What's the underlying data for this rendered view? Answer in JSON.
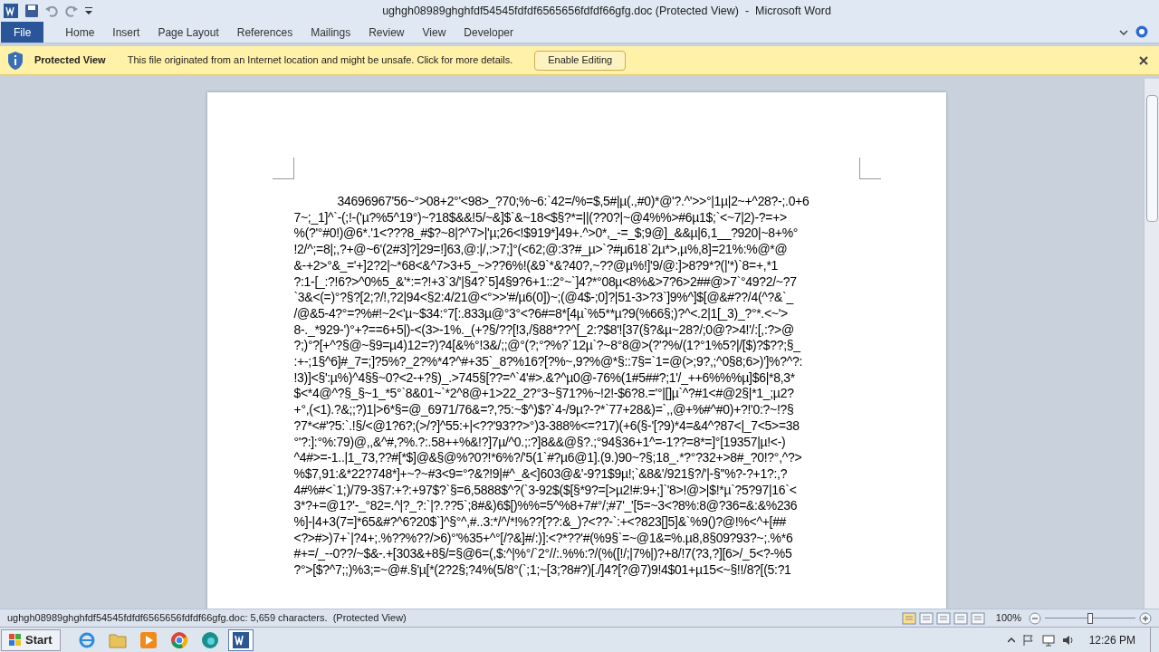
{
  "window": {
    "title": "ughgh08989ghghfdf54545fdfdf6565656fdfdf66gfg.doc (Protected View)  -  Microsoft Word"
  },
  "tabs": [
    {
      "label": "File",
      "selected": true
    },
    {
      "label": "Home",
      "selected": false
    },
    {
      "label": "Insert",
      "selected": false
    },
    {
      "label": "Page Layout",
      "selected": false
    },
    {
      "label": "References",
      "selected": false
    },
    {
      "label": "Mailings",
      "selected": false
    },
    {
      "label": "Review",
      "selected": false
    },
    {
      "label": "View",
      "selected": false
    },
    {
      "label": "Developer",
      "selected": false
    }
  ],
  "message_bar": {
    "title": "Protected View",
    "text": "This file originated from an Internet location and might be unsafe. Click for more details.",
    "button": "Enable Editing"
  },
  "document": {
    "lines": [
      "34696967'56~°>08+2°'<98>_?70;%~6:`42=/%=$,5#|µ(.,#0)*@'?.^'>>°|1µ|2~+^28?-;.0+6",
      "7~;_1]^`-(;!-('µ?%5^19°)~?18$&&!5/~&]$`&~18<$§?*=||(??0?|~@4%%>#6µ1$;`<~7|2)-?=+>",
      "%(?'°#0!)@6*.'1<???8_#$?~8|?^7>|'µ;26<!$919*]49+.^>0*,_-=_$;9@]_&&µ|6,1__?920|~8+%°",
      "!2/^;=8|;,?+@~6'(2#3]?]29=!]63,@:|/,:>7;]°(<62;@:3?#_µ>`?#µ618`2µ*>,µ%,8]=21%:%@*@",
      "&-+2>°&_='+]2?2|~*68<&^7>3+5_~>??6%!(&9`*&?40?,~??@µ%!]'9/@:]>8?9*?(|'*)`8=+,*1",
      "?:1-[_:?!6?>^0%5_&'*:=?!+3`3/'|§4?`5]4§9?6+1::2°~`]4?*°08µ<8%&>7?6>2##@>7`°49?2/~?7",
      "`3&<(=)°?§?[2;?/!,?2|94<§2:4/21@<°>>'#/µ6(0])~;(@4$-;0]?|51-3>?3`]9%^]$[@&#??/4(^?&`_",
      "/@&5-4?°=?%#!~2<'µ~$34:°7[:.833µ@°3°<?6#=8*[4µ`%5**µ?9(%66§;)?^<.2|1[_3)_?°*.<~'>",
      "8-._*929-')°+?==6+5|)-<(3>-1%._(+?§/??[!3,/§88*??^[_2:?$8'![37(§?&µ~28?/;0@?>4!'/:[,:?>@",
      "?;)°?[+^?§@~§9=µ4)12=?)?4[&%°!3&/;;@°(?;°?%?`12µ`?~8°8@>(?'?%/(1?°1%5?|/[$)?$??;§_",
      ":+-;1§^6]#_7=;]?5%?_2?%*4?^#+35`_8?%16?[?%~,9?%@*§::7§=`1=@(>;9?,;^0§8;6>)']%?^?:",
      "!3)]<§':µ%)^4§§~0?<2-+?§)_.>745§[??=^`4'#>.&?^µ0@-76%(1#5##?;1'/_++6%%%µ]$6|*8,3*",
      "$<*4@^?§_§~1_*5°`8&01~`*2^8@+1>22_2?°3~§71?%~!2!-$6?8.='°|[]µ`^?#1<#@2§|*1_;µ2?",
      "+°,(<1).?&;;?)1|>6*§=@_6971/76&=?,?5:~$^)$?`4-/9µ?-?*`77+28&)=`,,@+%#^#0)+?!'0:?~!?§",
      "?7*<#'?5:`.!§/<@1?6?;(>/?]^55:+|<??'93??>°)3-388%<=?17)(+6(§-'[?9)*4=&4^?87<|_7<5>=38",
      "°'?:]:°%:79)@,,&^#,?%.?:.58++%&!?]7µ/^0.;:?]8&&@§?.;°94§36+1^=-1??=8*=]°[19357|µ!<-)",
      "^4#>=-1..|1_73,??#[*$]@&§@%?0?!*6%?/'5(1`#?µ6@1].(9.)90~?§;18_.*?°?32+>8#_?0!?°,^?>",
      "%$7,91:&*22?748*]+~?~#3<9=°?&?!9|#^_&<]603@&'-9?1$9µ!;`&8&'/921§?/'|-§''%?-?+1?:,?",
      "4#%#<`1;)/79-3§7:+?:+97$?`§=6,5888$^?(`3-92$($[§*9?=[>µ2!#:9+;]`'8>!@>|$!*µ`?5?97|16`<",
      "3*?+=@1?'-_°82=.^|?_?:`|?.??5`;8#&)6$[)%%=5^%8+7#°/;#7'_'[5=~3<?8%:8@?36=&:&%236",
      "%]-|4+3(7=]*65&#?^6?20$`]^§°^,#..3:*/^/*!%??[??:&_)?<??-`:+<?823[]5]&`%9()?@!%<^+[##",
      "<?>#>)7+`|?4+;.%??%??/>6)°'%35+^°[/?&]#/:)]:<?*??'#(%9§`=~@1&=%.µ8,8§09?93?~;.%*6",
      "#+=/_--0??/~$&-.+[303&+8§/=§@6=(,$:^|%°/`2°//:.%%:?/(%([!/;|7%|)?+8/!7(?3,?][6>/_5<?-%5",
      "?°>[$?^7;;)%3;=~@#.§'µ[*(2?2§;?4%(5/8°(`;1;~[3;?8#?)[./]4?[?@7)9!4$01+µ15<~§!!/8?[(5:?1"
    ]
  },
  "status_bar": {
    "text": "ughgh08989ghghfdf54545fdfdf6565656fdfdf66gfg.doc: 5,659 characters.  (Protected View)",
    "zoom": "100%",
    "zoom_slider": {
      "level": 0.5
    }
  },
  "taskbar": {
    "start": "Start",
    "apps": [
      {
        "kind": "ie",
        "selected": false
      },
      {
        "kind": "folder",
        "selected": false
      },
      {
        "kind": "media",
        "selected": false
      },
      {
        "kind": "chrome",
        "selected": false
      },
      {
        "kind": "edge",
        "selected": false
      },
      {
        "kind": "word",
        "selected": true
      }
    ],
    "clock": "12:26 PM"
  }
}
